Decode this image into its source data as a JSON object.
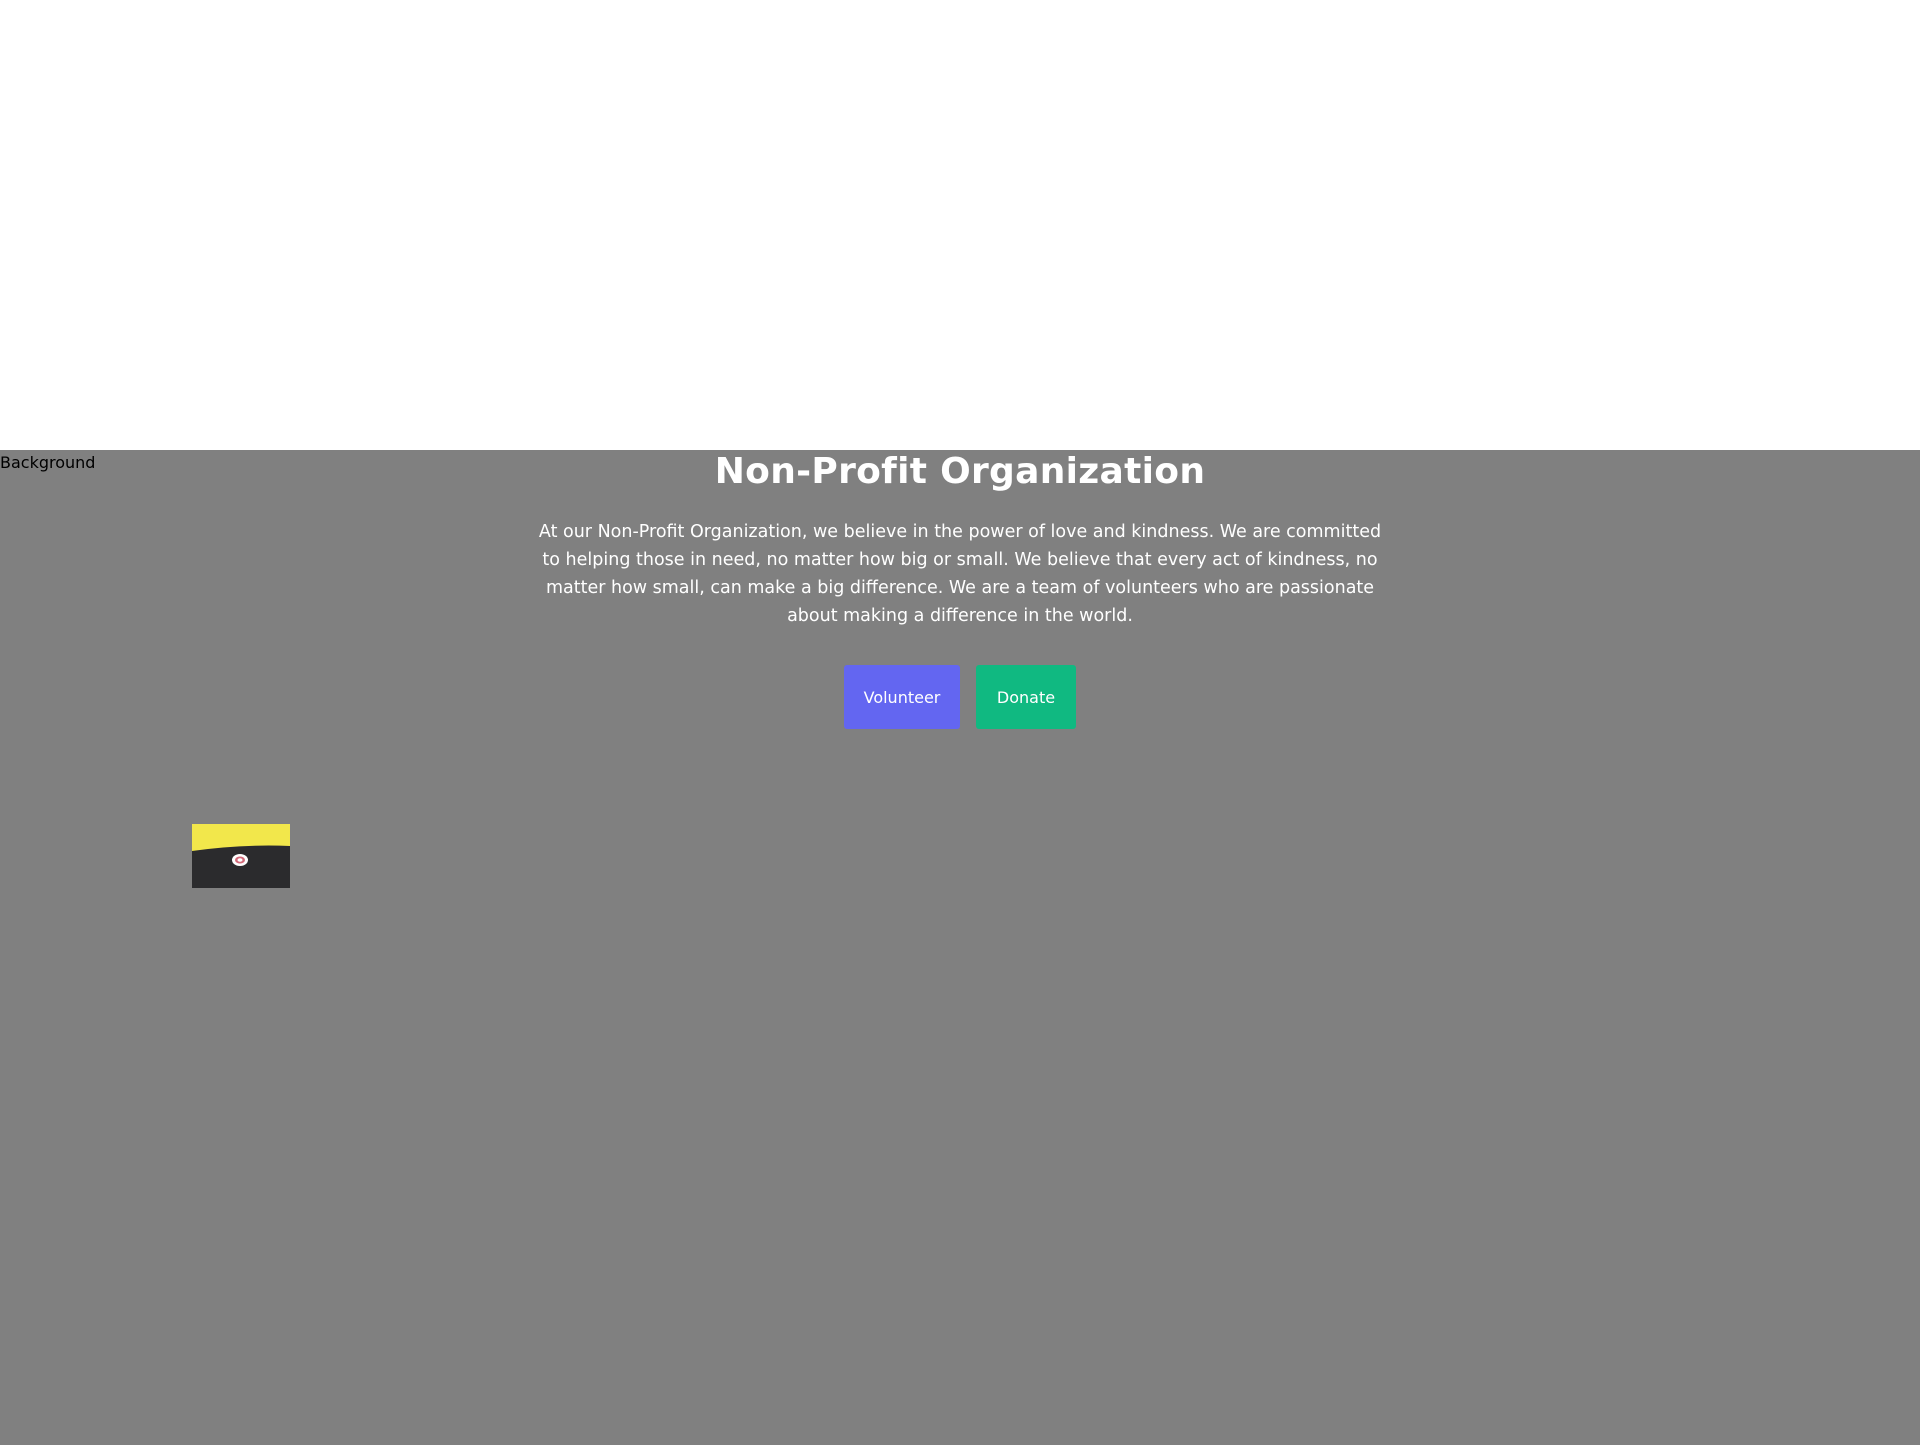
{
  "background_alt": "Background",
  "hero": {
    "title": "Non-Profit Organization",
    "text": "At our Non-Profit Organization, we believe in the power of love and kindness. We are committed to helping those in need, no matter how big or small. We believe that every act of kindness, no matter how small, can make a big difference. We are a team of volunteers who are passionate about making a difference in the world."
  },
  "buttons": {
    "volunteer": "Volunteer",
    "donate": "Donate"
  },
  "colors": {
    "hero_background": "#808080",
    "volunteer_button": "#6366f1",
    "donate_button": "#10b981",
    "thumbnail_yellow": "#f2e74b",
    "thumbnail_dark": "#2b2b2d"
  },
  "thumbnail": {
    "icon": "badge-image"
  }
}
